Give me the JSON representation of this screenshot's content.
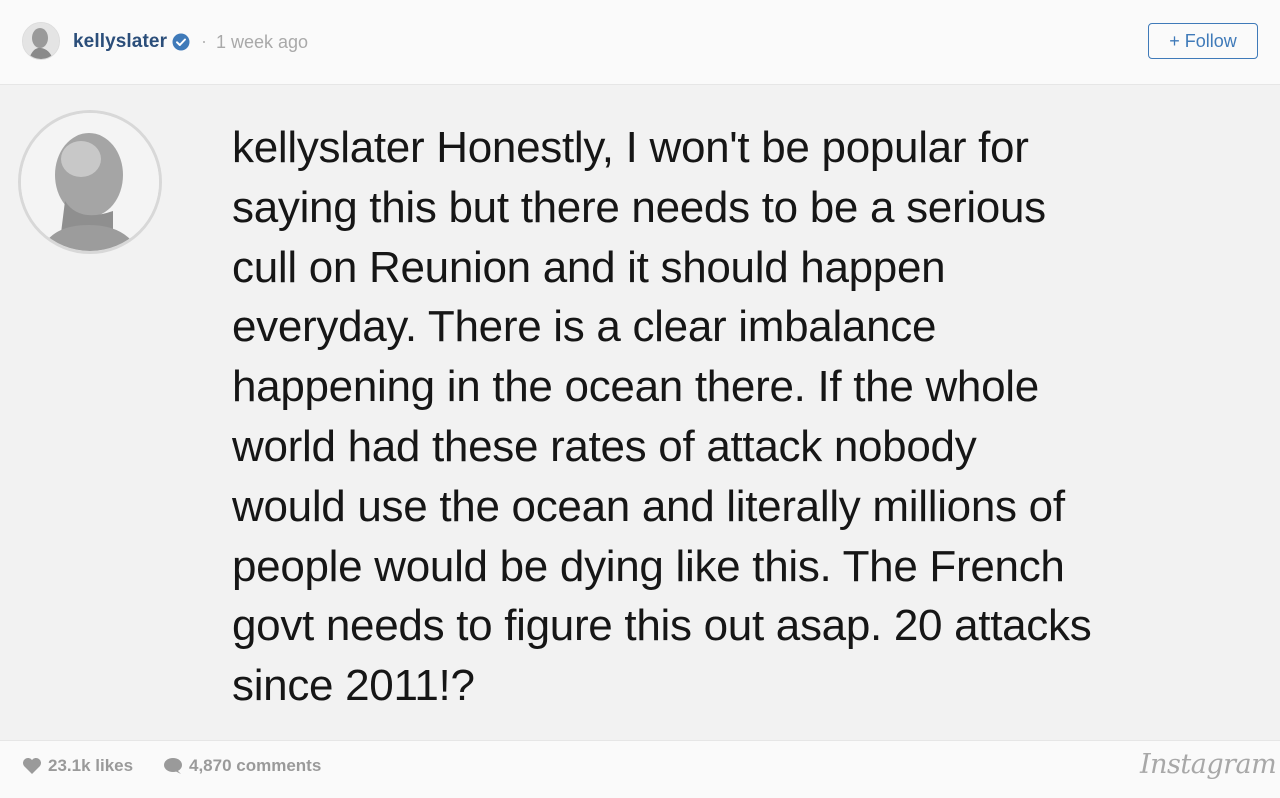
{
  "header": {
    "username": "kellyslater",
    "separator": "·",
    "timestamp": "1 week ago",
    "follow_label": "+ Follow",
    "verified_icon": "verified-badge-icon",
    "accent_color": "#3f7ab9"
  },
  "comment": {
    "username": "kellyslater",
    "lines": [
      "Honestly, I won't be popular for",
      "saying this but there needs to be a serious",
      "cull on Reunion and it should happen",
      "everyday. There is a clear imbalance",
      "happening in the ocean there. If the whole",
      "world had these rates of attack nobody",
      "would use the ocean and literally millions of",
      "people would be dying like this. The French",
      "govt needs to figure this out asap. 20 attacks",
      "since 2011!?"
    ]
  },
  "footer": {
    "likes": "23.1k likes",
    "comments": "4,870 comments",
    "brand": "Instagram",
    "like_icon": "heart-icon",
    "comment_icon": "speech-bubble-icon"
  }
}
